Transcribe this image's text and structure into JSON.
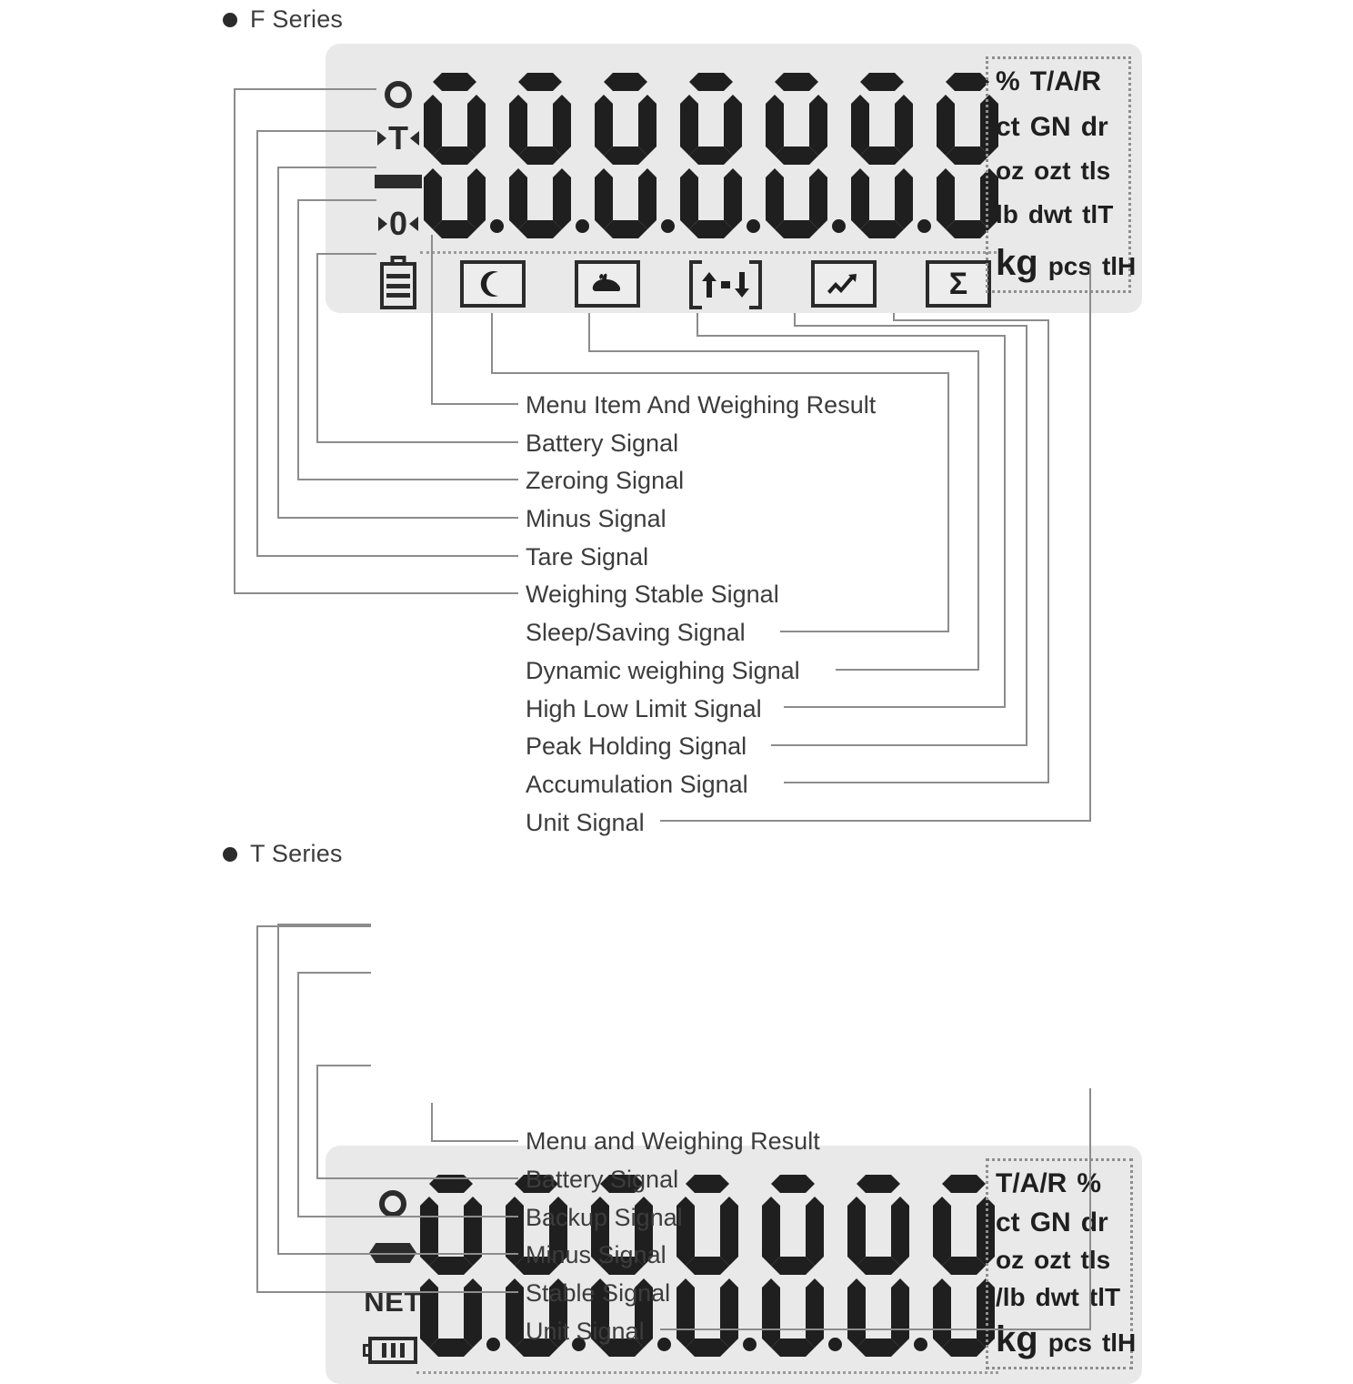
{
  "f_series": {
    "heading": "F Series",
    "display": {
      "digit_count": 7,
      "digit_glyph": "8",
      "decimal_points": 6,
      "indicators": [
        {
          "name": "stable-circle",
          "icon": "circle-icon"
        },
        {
          "name": "tare",
          "icon": "tare-arrows-icon",
          "letter": "T"
        },
        {
          "name": "minus",
          "icon": "minus-bar-icon"
        },
        {
          "name": "zero",
          "icon": "zero-arrows-icon",
          "letter": "0"
        },
        {
          "name": "battery",
          "icon": "battery-vertical-icon"
        }
      ],
      "status_icons": [
        {
          "name": "sleep",
          "icon": "moon-icon"
        },
        {
          "name": "dynamic-weighing",
          "icon": "animal-icon"
        },
        {
          "name": "high-low-limit",
          "icon": "up-down-limit-icon"
        },
        {
          "name": "peak-holding",
          "icon": "rising-arrow-icon"
        },
        {
          "name": "accumulation",
          "icon": "sigma-icon",
          "glyph": "Σ"
        }
      ],
      "unit_rows": [
        [
          "%",
          "T/A/R"
        ],
        [
          "ct",
          "GN",
          "dr"
        ],
        [
          "oz",
          "ozt",
          "tls"
        ],
        [
          "lb",
          "dwt",
          "tlT"
        ],
        [
          "kg",
          "pcs",
          "tlH"
        ]
      ]
    },
    "labels": [
      "Menu Item And Weighing Result",
      "Battery Signal",
      "Zeroing Signal",
      "Minus Signal",
      "Tare Signal",
      "Weighing Stable Signal",
      "Sleep/Saving Signal",
      "Dynamic weighing Signal",
      "High Low Limit Signal",
      "Peak Holding Signal",
      "Accumulation Signal",
      "Unit Signal"
    ]
  },
  "t_series": {
    "heading": "T Series",
    "display": {
      "digit_count": 7,
      "digit_glyph": "8",
      "decimal_points": 6,
      "indicators": [
        {
          "name": "stable-circle",
          "icon": "circle-icon"
        },
        {
          "name": "backup",
          "icon": "hex-bar-icon"
        },
        {
          "name": "net",
          "icon": "net-text-icon",
          "text": "NET"
        },
        {
          "name": "battery",
          "icon": "battery-horizontal-icon"
        }
      ],
      "unit_rows": [
        [
          "T/A/R",
          "%"
        ],
        [
          "ct",
          "GN",
          "dr"
        ],
        [
          "oz",
          "ozt",
          "tls"
        ],
        [
          "/lb",
          "dwt",
          "tlT"
        ],
        [
          "kg",
          "pcs",
          "tlH"
        ]
      ]
    },
    "labels": [
      "Menu and Weighing Result",
      "Battery Signal",
      "Backup Signal",
      "Minus Signal",
      "Stable Signal",
      "Unit Signal"
    ]
  },
  "colors": {
    "panel_bg": "#e9e9e9",
    "segment": "#1f1f1f",
    "text": "#3c3c3c",
    "leader": "#8c8c8c"
  }
}
